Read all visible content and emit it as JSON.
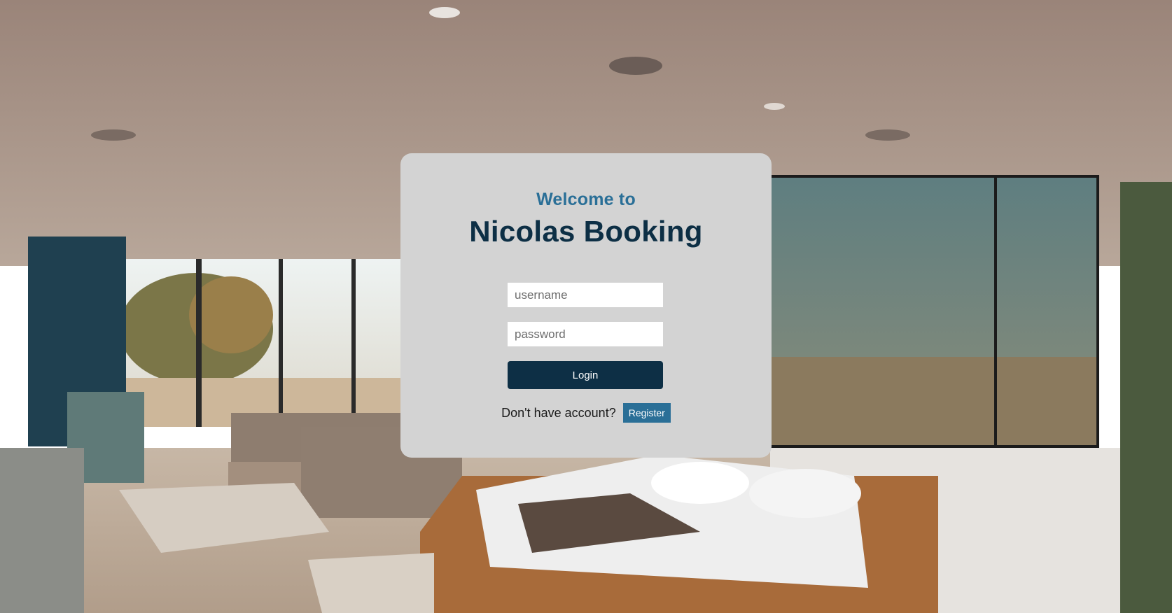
{
  "login_card": {
    "welcome_text": "Welcome to",
    "brand_name": "Nicolas Booking",
    "username_placeholder": "username",
    "username_value": "",
    "password_placeholder": "password",
    "password_value": "",
    "login_label": "Login",
    "register_prompt": "Don't have account?",
    "register_label": "Register"
  },
  "colors": {
    "card_background": "#d3d3d3",
    "welcome_text": "#2a6f97",
    "brand_text": "#0d2f45",
    "login_button": "#0d2f45",
    "register_button": "#2a6f97"
  }
}
